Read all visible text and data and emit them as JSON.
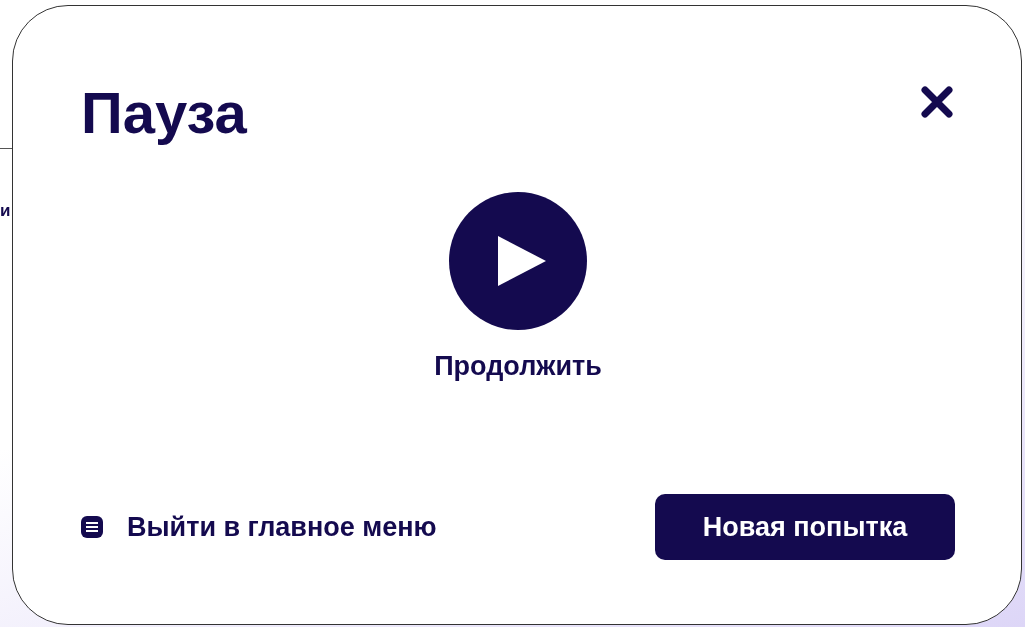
{
  "background": {
    "text_fragment": "и"
  },
  "dialog": {
    "title": "Пауза",
    "closable": true,
    "resume": {
      "label": "Продолжить"
    },
    "exit_link": {
      "label": "Выйти в главное меню"
    },
    "retry_button": {
      "label": "Новая попытка"
    }
  }
}
